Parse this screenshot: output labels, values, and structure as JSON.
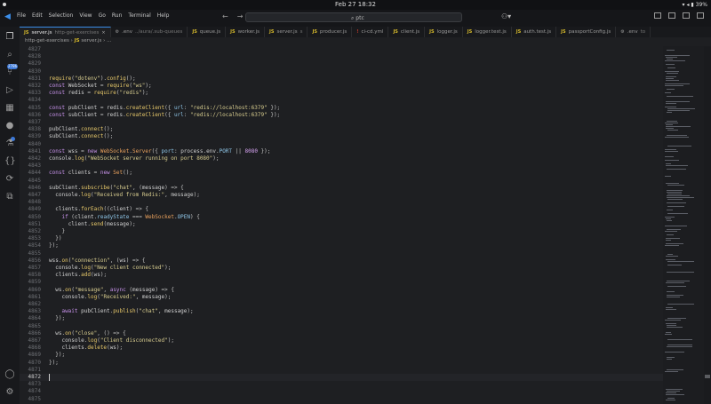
{
  "system_bar": {
    "clock": "Feb 27  18:32",
    "battery": "39%"
  },
  "menu": [
    "File",
    "Edit",
    "Selection",
    "View",
    "Go",
    "Run",
    "Terminal",
    "Help"
  ],
  "command_center": {
    "text": "ptc"
  },
  "activity_bar": {
    "badge_count": "2786"
  },
  "tabs": [
    {
      "label": "server.js",
      "detail": "http-get-exercises",
      "kind": "js",
      "active": true
    },
    {
      "label": ".env",
      "detail": "../aura/.sub-queues",
      "kind": "env",
      "active": false
    },
    {
      "label": "queue.js",
      "kind": "js",
      "active": false
    },
    {
      "label": "worker.js",
      "kind": "js",
      "active": false
    },
    {
      "label": "server.js",
      "detail": "s",
      "kind": "js",
      "active": false
    },
    {
      "label": "producer.js",
      "kind": "js",
      "active": false
    },
    {
      "label": "ci-cd.yml",
      "kind": "yml",
      "active": false
    },
    {
      "label": "client.js",
      "kind": "js",
      "active": false
    },
    {
      "label": "logger.js",
      "kind": "js",
      "active": false
    },
    {
      "label": "logger.test.js",
      "kind": "js",
      "active": false
    },
    {
      "label": "auth.test.js",
      "kind": "js",
      "active": false
    },
    {
      "label": "passportConfig.js",
      "kind": "js",
      "active": false
    },
    {
      "label": ".env",
      "detail": "to",
      "kind": "env",
      "active": false
    }
  ],
  "breadcrumb": {
    "folder": "http-get-exercises",
    "file": "server.js",
    "more": "..."
  },
  "editor": {
    "current_line": "4872",
    "lines": [
      {
        "n": "4827",
        "tokens": []
      },
      {
        "n": "4828",
        "tokens": []
      },
      {
        "n": "4829",
        "tokens": []
      },
      {
        "n": "4830",
        "tokens": []
      },
      {
        "n": "4831",
        "tokens": [
          [
            "fn",
            "require"
          ],
          [
            "op",
            "("
          ],
          [
            "str",
            "\"dotenv\""
          ],
          [
            "op",
            ")."
          ],
          [
            "fn",
            "config"
          ],
          [
            "op",
            "();"
          ]
        ]
      },
      {
        "n": "4832",
        "tokens": [
          [
            "kw",
            "const "
          ],
          [
            "var",
            "WebSocket"
          ],
          [
            "op",
            " = "
          ],
          [
            "fn",
            "require"
          ],
          [
            "op",
            "("
          ],
          [
            "str",
            "\"ws\""
          ],
          [
            "op",
            ");"
          ]
        ]
      },
      {
        "n": "4833",
        "tokens": [
          [
            "kw",
            "const "
          ],
          [
            "var",
            "redis"
          ],
          [
            "op",
            " = "
          ],
          [
            "fn",
            "require"
          ],
          [
            "op",
            "("
          ],
          [
            "str",
            "\"redis\""
          ],
          [
            "op",
            ");"
          ]
        ]
      },
      {
        "n": "4834",
        "tokens": []
      },
      {
        "n": "4835",
        "tokens": [
          [
            "kw",
            "const "
          ],
          [
            "var",
            "pubClient"
          ],
          [
            "op",
            " = "
          ],
          [
            "var",
            "redis"
          ],
          [
            "op",
            "."
          ],
          [
            "fn",
            "createClient"
          ],
          [
            "op",
            "({ "
          ],
          [
            "prop",
            "url"
          ],
          [
            "op",
            ": "
          ],
          [
            "str",
            "\"redis://localhost:6379\""
          ],
          [
            "op",
            " });"
          ]
        ]
      },
      {
        "n": "4836",
        "tokens": [
          [
            "kw",
            "const "
          ],
          [
            "var",
            "subClient"
          ],
          [
            "op",
            " = "
          ],
          [
            "var",
            "redis"
          ],
          [
            "op",
            "."
          ],
          [
            "fn",
            "createClient"
          ],
          [
            "op",
            "({ "
          ],
          [
            "prop",
            "url"
          ],
          [
            "op",
            ": "
          ],
          [
            "str",
            "\"redis://localhost:6379\""
          ],
          [
            "op",
            " });"
          ]
        ]
      },
      {
        "n": "4837",
        "tokens": []
      },
      {
        "n": "4838",
        "tokens": [
          [
            "var",
            "pubClient"
          ],
          [
            "op",
            "."
          ],
          [
            "fn",
            "connect"
          ],
          [
            "op",
            "();"
          ]
        ]
      },
      {
        "n": "4839",
        "tokens": [
          [
            "var",
            "subClient"
          ],
          [
            "op",
            "."
          ],
          [
            "fn",
            "connect"
          ],
          [
            "op",
            "();"
          ]
        ]
      },
      {
        "n": "4840",
        "tokens": []
      },
      {
        "n": "4841",
        "tokens": [
          [
            "kw",
            "const "
          ],
          [
            "var",
            "wss"
          ],
          [
            "op",
            " = "
          ],
          [
            "kw",
            "new "
          ],
          [
            "cls",
            "WebSocket"
          ],
          [
            "op",
            "."
          ],
          [
            "cls",
            "Server"
          ],
          [
            "op",
            "({ "
          ],
          [
            "prop",
            "port"
          ],
          [
            "op",
            ": "
          ],
          [
            "var",
            "process"
          ],
          [
            "op",
            "."
          ],
          [
            "var",
            "env"
          ],
          [
            "op",
            "."
          ],
          [
            "prop",
            "PORT"
          ],
          [
            "op",
            " || "
          ],
          [
            "num",
            "8080"
          ],
          [
            "op",
            " });"
          ]
        ]
      },
      {
        "n": "4842",
        "tokens": [
          [
            "var",
            "console"
          ],
          [
            "op",
            "."
          ],
          [
            "fn",
            "log"
          ],
          [
            "op",
            "("
          ],
          [
            "str",
            "\"WebSocket server running on port 8080\""
          ],
          [
            "op",
            ");"
          ]
        ]
      },
      {
        "n": "4843",
        "tokens": []
      },
      {
        "n": "4844",
        "tokens": [
          [
            "kw",
            "const "
          ],
          [
            "var",
            "clients"
          ],
          [
            "op",
            " = "
          ],
          [
            "kw",
            "new "
          ],
          [
            "cls",
            "Set"
          ],
          [
            "op",
            "();"
          ]
        ]
      },
      {
        "n": "4845",
        "tokens": []
      },
      {
        "n": "4846",
        "tokens": [
          [
            "var",
            "subClient"
          ],
          [
            "op",
            "."
          ],
          [
            "fn",
            "subscribe"
          ],
          [
            "op",
            "("
          ],
          [
            "str",
            "\"chat\""
          ],
          [
            "op",
            ", ("
          ],
          [
            "var",
            "message"
          ],
          [
            "op",
            ") => {"
          ]
        ]
      },
      {
        "n": "4847",
        "tokens": [
          [
            "op",
            "  "
          ],
          [
            "var",
            "console"
          ],
          [
            "op",
            "."
          ],
          [
            "fn",
            "log"
          ],
          [
            "op",
            "("
          ],
          [
            "str",
            "\"Received from Redis:\""
          ],
          [
            "op",
            ", "
          ],
          [
            "var",
            "message"
          ],
          [
            "op",
            ");"
          ]
        ]
      },
      {
        "n": "4848",
        "tokens": []
      },
      {
        "n": "4849",
        "tokens": [
          [
            "op",
            "  "
          ],
          [
            "var",
            "clients"
          ],
          [
            "op",
            "."
          ],
          [
            "fn",
            "forEach"
          ],
          [
            "op",
            "(("
          ],
          [
            "var",
            "client"
          ],
          [
            "op",
            ") => {"
          ]
        ]
      },
      {
        "n": "4850",
        "tokens": [
          [
            "op",
            "    "
          ],
          [
            "kw",
            "if "
          ],
          [
            "op",
            "("
          ],
          [
            "var",
            "client"
          ],
          [
            "op",
            "."
          ],
          [
            "prop",
            "readyState"
          ],
          [
            "op",
            " === "
          ],
          [
            "cls",
            "WebSocket"
          ],
          [
            "op",
            "."
          ],
          [
            "prop",
            "OPEN"
          ],
          [
            "op",
            ") {"
          ]
        ]
      },
      {
        "n": "4851",
        "tokens": [
          [
            "op",
            "      "
          ],
          [
            "var",
            "client"
          ],
          [
            "op",
            "."
          ],
          [
            "fn",
            "send"
          ],
          [
            "op",
            "("
          ],
          [
            "var",
            "message"
          ],
          [
            "op",
            ");"
          ]
        ]
      },
      {
        "n": "4852",
        "tokens": [
          [
            "op",
            "    }"
          ]
        ]
      },
      {
        "n": "4853",
        "tokens": [
          [
            "op",
            "  })"
          ]
        ]
      },
      {
        "n": "4854",
        "tokens": [
          [
            "op",
            "});"
          ]
        ]
      },
      {
        "n": "4855",
        "tokens": []
      },
      {
        "n": "4856",
        "tokens": [
          [
            "var",
            "wss"
          ],
          [
            "op",
            "."
          ],
          [
            "fn",
            "on"
          ],
          [
            "op",
            "("
          ],
          [
            "str",
            "\"connection\""
          ],
          [
            "op",
            ", ("
          ],
          [
            "var",
            "ws"
          ],
          [
            "op",
            ") => {"
          ]
        ]
      },
      {
        "n": "4857",
        "tokens": [
          [
            "op",
            "  "
          ],
          [
            "var",
            "console"
          ],
          [
            "op",
            "."
          ],
          [
            "fn",
            "log"
          ],
          [
            "op",
            "("
          ],
          [
            "str",
            "\"New client connected\""
          ],
          [
            "op",
            ");"
          ]
        ]
      },
      {
        "n": "4858",
        "tokens": [
          [
            "op",
            "  "
          ],
          [
            "var",
            "clients"
          ],
          [
            "op",
            "."
          ],
          [
            "fn",
            "add"
          ],
          [
            "op",
            "("
          ],
          [
            "var",
            "ws"
          ],
          [
            "op",
            ");"
          ]
        ]
      },
      {
        "n": "4859",
        "tokens": []
      },
      {
        "n": "4860",
        "tokens": [
          [
            "op",
            "  "
          ],
          [
            "var",
            "ws"
          ],
          [
            "op",
            "."
          ],
          [
            "fn",
            "on"
          ],
          [
            "op",
            "("
          ],
          [
            "str",
            "\"message\""
          ],
          [
            "op",
            ", "
          ],
          [
            "kw",
            "async "
          ],
          [
            "op",
            "("
          ],
          [
            "var",
            "message"
          ],
          [
            "op",
            ") => {"
          ]
        ]
      },
      {
        "n": "4861",
        "tokens": [
          [
            "op",
            "    "
          ],
          [
            "var",
            "console"
          ],
          [
            "op",
            "."
          ],
          [
            "fn",
            "log"
          ],
          [
            "op",
            "("
          ],
          [
            "str",
            "\"Received:\""
          ],
          [
            "op",
            ", "
          ],
          [
            "var",
            "message"
          ],
          [
            "op",
            ");"
          ]
        ]
      },
      {
        "n": "4862",
        "tokens": []
      },
      {
        "n": "4863",
        "tokens": [
          [
            "op",
            "    "
          ],
          [
            "kw",
            "await "
          ],
          [
            "var",
            "pubClient"
          ],
          [
            "op",
            "."
          ],
          [
            "fn",
            "publish"
          ],
          [
            "op",
            "("
          ],
          [
            "str",
            "\"chat\""
          ],
          [
            "op",
            ", "
          ],
          [
            "var",
            "message"
          ],
          [
            "op",
            ");"
          ]
        ]
      },
      {
        "n": "4864",
        "tokens": [
          [
            "op",
            "  });"
          ]
        ]
      },
      {
        "n": "4865",
        "tokens": []
      },
      {
        "n": "4866",
        "tokens": [
          [
            "op",
            "  "
          ],
          [
            "var",
            "ws"
          ],
          [
            "op",
            "."
          ],
          [
            "fn",
            "on"
          ],
          [
            "op",
            "("
          ],
          [
            "str",
            "\"close\""
          ],
          [
            "op",
            ", () => {"
          ]
        ]
      },
      {
        "n": "4867",
        "tokens": [
          [
            "op",
            "    "
          ],
          [
            "var",
            "console"
          ],
          [
            "op",
            "."
          ],
          [
            "fn",
            "log"
          ],
          [
            "op",
            "("
          ],
          [
            "str",
            "\"Client disconnected\""
          ],
          [
            "op",
            ");"
          ]
        ]
      },
      {
        "n": "4868",
        "tokens": [
          [
            "op",
            "    "
          ],
          [
            "var",
            "clients"
          ],
          [
            "op",
            "."
          ],
          [
            "fn",
            "delete"
          ],
          [
            "op",
            "("
          ],
          [
            "var",
            "ws"
          ],
          [
            "op",
            ");"
          ]
        ]
      },
      {
        "n": "4869",
        "tokens": [
          [
            "op",
            "  });"
          ]
        ]
      },
      {
        "n": "4870",
        "tokens": [
          [
            "op",
            "});"
          ]
        ]
      },
      {
        "n": "4871",
        "tokens": []
      },
      {
        "n": "4872",
        "tokens": []
      },
      {
        "n": "4873",
        "tokens": []
      },
      {
        "n": "4874",
        "tokens": []
      },
      {
        "n": "4875",
        "tokens": []
      }
    ]
  }
}
